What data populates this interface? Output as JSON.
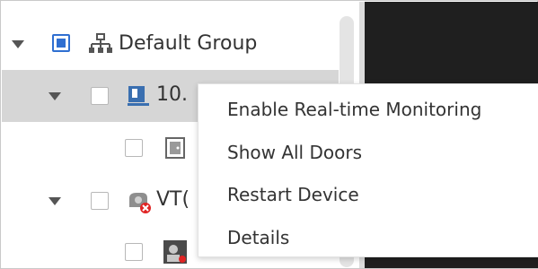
{
  "tree": {
    "root": {
      "label": "Default Group",
      "expanded": true,
      "checkbox_state": "partial"
    },
    "nodes": [
      {
        "label": "10.",
        "type": "device",
        "expanded": true,
        "checked": false
      },
      {
        "label": "",
        "type": "door",
        "checked": false
      },
      {
        "label": "VT(",
        "type": "vto-device-offline",
        "expanded": true,
        "checked": false
      },
      {
        "label": "",
        "type": "camera-channel",
        "checked": false
      }
    ]
  },
  "context_menu": {
    "items": [
      {
        "label": "Enable Real-time Monitoring"
      },
      {
        "label": "Show All Doors"
      },
      {
        "label": "Restart Device"
      },
      {
        "label": "Details"
      }
    ]
  },
  "colors": {
    "selected_row": "#d6d6d6",
    "checkbox_accent": "#2f6fd1",
    "video_background": "#1f1f1f",
    "offline_badge": "#e02424"
  }
}
